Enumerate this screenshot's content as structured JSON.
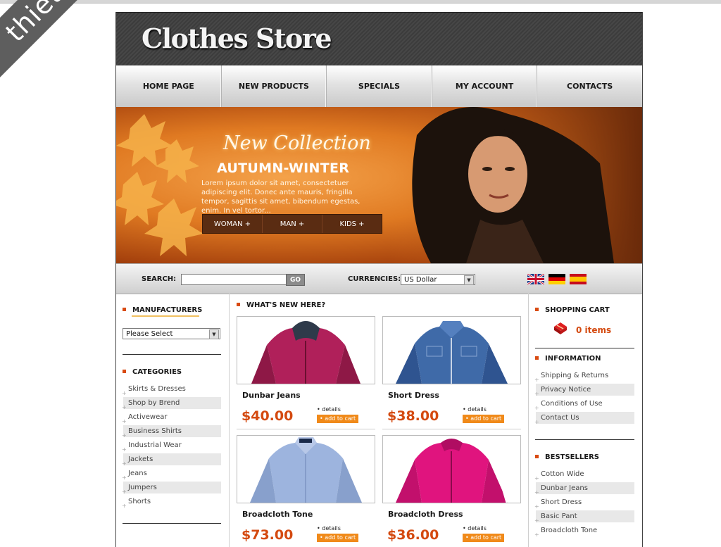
{
  "watermark": "thietkeweb.com",
  "logo": {
    "text": "Clothes Store"
  },
  "nav": [
    "HOME PAGE",
    "NEW PRODUCTS",
    "SPECIALS",
    "MY ACCOUNT",
    "CONTACTS"
  ],
  "banner": {
    "script": "New Collection",
    "title": "AUTUMN-WINTER",
    "text": "Lorem ipsum dolor sit amet, consectetuer adipiscing elit. Donec ante mauris, fringilla tempor, sagittis sit amet, bibendum egestas, enim. In vel tortor...",
    "buttons": [
      "WOMAN +",
      "MAN +",
      "KIDS +"
    ]
  },
  "search": {
    "label": "SEARCH:",
    "value": "",
    "go": "GO"
  },
  "currencies": {
    "label": "CURRENCIES:",
    "selected": "US Dollar"
  },
  "flags": [
    "uk-flag-icon",
    "germany-flag-icon",
    "spain-flag-icon"
  ],
  "manufacturers": {
    "title": "MANUFACTURERS",
    "selected": "Please Select"
  },
  "categories": {
    "title": "CATEGORIES",
    "items": [
      "Skirts & Dresses",
      "Shop by Brend",
      "Activewear",
      "Business Shirts",
      "Industrial Wear",
      "Jackets",
      "Jeans",
      "Jumpers",
      "Shorts"
    ]
  },
  "whats_new": {
    "title": "WHAT'S NEW HERE?",
    "details": "• details",
    "add_to_cart": "• add to cart",
    "products": [
      {
        "name": "Dunbar Jeans",
        "price": "$40.00",
        "image": "magenta-jacket"
      },
      {
        "name": "Short Dress",
        "price": "$38.00",
        "image": "denim-jacket"
      },
      {
        "name": "Broadcloth Tone",
        "price": "$73.00",
        "image": "blue-shirt"
      },
      {
        "name": "Broadcloth Dress",
        "price": "$36.00",
        "image": "pink-jacket"
      }
    ]
  },
  "shopping_cart": {
    "title": "SHOPPING CART",
    "items": "0 items"
  },
  "information": {
    "title": "INFORMATION",
    "items": [
      "Shipping & Returns",
      "Privacy Notice",
      "Conditions of Use",
      "Contact Us"
    ]
  },
  "bestsellers": {
    "title": "BESTSELLERS",
    "items": [
      "Cotton Wide",
      "Dunbar Jeans",
      "Short Dress",
      "Basic Pant",
      "Broadcloth Tone"
    ]
  },
  "colors": {
    "accent": "#d44a10",
    "button": "#f08a1a",
    "header": "#444444"
  }
}
